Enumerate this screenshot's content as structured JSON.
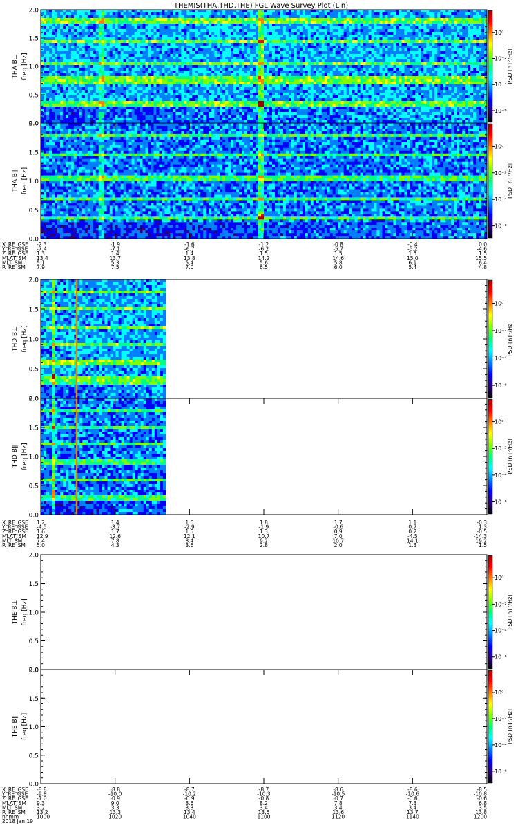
{
  "chart_data": {
    "type": "heatmap",
    "title": "THEMIS(THA,THD,THE) FGL Wave Survey Plot (Lin)",
    "colorbar": {
      "label": "PSD [nT²/Hz]",
      "ticks": [
        "10⁰",
        "10⁻²",
        "10⁻⁴",
        "10⁻⁶"
      ],
      "colors": [
        "#000000",
        "#2a007f",
        "#0000ff",
        "#0080ff",
        "#00ffff",
        "#00ff80",
        "#80ff00",
        "#ffff00",
        "#ff8000",
        "#ff0000",
        "#a00000"
      ]
    },
    "y_ticks": [
      "0.0",
      "0.5",
      "1.0",
      "1.5",
      "2.0"
    ],
    "ylim": [
      0,
      2.0
    ],
    "panels": [
      {
        "ylabel": "THA B⊥",
        "units": "freq [Hz]",
        "data_fraction": 1.0,
        "lines": [
          0.32,
          0.36,
          0.7,
          0.78,
          1.05,
          1.45,
          1.8
        ],
        "spike": 0.49,
        "spike2": 0.13
      },
      {
        "ylabel": "THA B∥",
        "units": "freq [Hz]",
        "data_fraction": 1.0,
        "lines": [
          0.35,
          0.7,
          1.05,
          1.45,
          1.8
        ],
        "spike": 0.49,
        "spike2": 0.13
      },
      {
        "ylabel": "THD B⊥",
        "units": "freq [Hz]",
        "data_fraction": 0.28,
        "lines": [
          0.25,
          0.32,
          0.6,
          0.9,
          1.2,
          1.5,
          1.8
        ],
        "spike": 0.09
      },
      {
        "ylabel": "THD B∥",
        "units": "freq [Hz]",
        "data_fraction": 0.28,
        "lines": [
          0.25,
          0.32,
          0.6,
          0.9,
          1.2,
          1.5,
          1.8
        ],
        "spike": 0.09
      },
      {
        "ylabel": "THE B⊥",
        "units": "freq [Hz]",
        "data_fraction": 0.0,
        "lines": []
      },
      {
        "ylabel": "THE B∥",
        "units": "freq [Hz]",
        "data_fraction": 0.0,
        "lines": []
      }
    ],
    "ephemeris": [
      {
        "labels": [
          "X_RE_GSE",
          "Y_RE_GSE",
          "Z_RE_GSE",
          "MLAT_SM",
          "MLT_SM",
          "R_RE_SM"
        ],
        "values": [
          [
            "-2.3",
            "-1.9",
            "-1.6",
            "-1.2",
            "-0.8",
            "-0.4",
            "0.0"
          ],
          [
            "-7.4",
            "-7.1",
            "-6.7",
            "-6.2",
            "-5.7",
            "-5.2",
            "-4.6"
          ],
          [
            "1.3",
            "1.4",
            "1.4",
            "1.5",
            "1.5",
            "1.5",
            "1.5"
          ],
          [
            "13.4",
            "13.7",
            "13.8",
            "14.2",
            "14.6",
            "15.0",
            "15.5"
          ],
          [
            "5.1",
            "5.3",
            "5.4",
            "5.6",
            "5.8",
            "6.1",
            "6.4"
          ],
          [
            "7.9",
            "7.5",
            "7.0",
            "6.5",
            "6.0",
            "5.4",
            "4.8"
          ]
        ]
      },
      {
        "labels": [
          "X_RE_GSE",
          "Y_RE_GSE",
          "Z_RE_GSE",
          "MLAT_SM",
          "MLT_SM",
          "R_RE_SM"
        ],
        "values": [
          [
            "1.2",
            "1.4",
            "1.6",
            "1.8",
            "1.7",
            "1.1",
            "-0.3"
          ],
          [
            "-4.5",
            "-3.7",
            "-2.9",
            "-1.9",
            "-0.6",
            "0.7",
            "1.3"
          ],
          [
            "1.6",
            "1.7",
            "1.5",
            "1.3",
            "0.9",
            "0.2",
            "-0.5"
          ],
          [
            "12.9",
            "12.6",
            "12.1",
            "10.7",
            "7.0",
            "-4.5",
            "-14.3"
          ],
          [
            "7.4",
            "7.8",
            "8.4",
            "9.2",
            "10.7",
            "14.1",
            "19.2"
          ],
          [
            "5.0",
            "4.3",
            "3.6",
            "2.8",
            "2.0",
            "1.3",
            "1.5"
          ]
        ]
      },
      {
        "labels": [
          "X_RE_GSE",
          "Y_RE_GSE",
          "Z_RE_GSE",
          "MLAT_SM",
          "MLT_SM",
          "R_RE_SM",
          "hhmm",
          "2018 Jan 19"
        ],
        "values": [
          [
            "-8.8",
            "-8.8",
            "-8.7",
            "-8.7",
            "-8.6",
            "-8.6",
            "-8.5"
          ],
          [
            "-9.8",
            "-10.0",
            "-10.2",
            "-10.3",
            "-10.5",
            "-10.6",
            "-10.8"
          ],
          [
            "-1.0",
            "-0.9",
            "-0.9",
            "-0.8",
            "-0.7",
            "-0.6",
            "-0.6"
          ],
          [
            "9.3",
            "9.0",
            "8.6",
            "8.2",
            "7.8",
            "7.3",
            "6.8"
          ],
          [
            "3.2",
            "3.3",
            "3.3",
            "3.4",
            "3.4",
            "3.4",
            "3.5"
          ],
          [
            "13.2",
            "13.3",
            "13.4",
            "13.5",
            "13.6",
            "13.7",
            "13.8"
          ],
          [
            "1000",
            "1020",
            "1040",
            "1100",
            "1120",
            "1140",
            "1200"
          ],
          [
            "",
            "",
            "",
            "",
            "",
            "",
            ""
          ]
        ]
      }
    ]
  }
}
